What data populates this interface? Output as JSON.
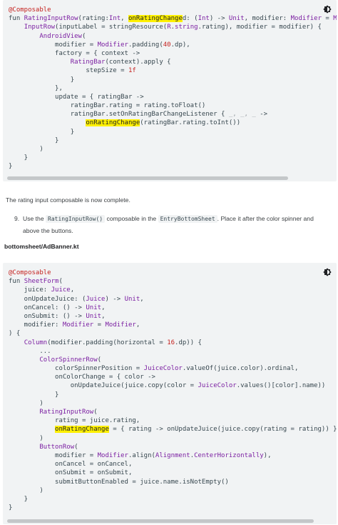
{
  "code_block_1": {
    "lines": [
      [
        {
          "t": "@Composable",
          "c": "ann"
        }
      ],
      [
        {
          "t": "fun ",
          "c": "kw"
        },
        {
          "t": "RatingInputRow",
          "c": "fn"
        },
        {
          "t": "(rating:",
          "c": "plain"
        },
        {
          "t": "Int",
          "c": "type"
        },
        {
          "t": ", ",
          "c": "plain"
        },
        {
          "t": "onRatingChange",
          "c": "hl"
        },
        {
          "t": "d: (",
          "c": "plain"
        },
        {
          "t": "Int",
          "c": "type"
        },
        {
          "t": ") -> ",
          "c": "plain"
        },
        {
          "t": "Unit",
          "c": "type"
        },
        {
          "t": ", modifier: ",
          "c": "plain"
        },
        {
          "t": "Modifier",
          "c": "type"
        },
        {
          "t": " = ",
          "c": "plain"
        },
        {
          "t": "Modi",
          "c": "type"
        }
      ],
      [
        {
          "t": "    ",
          "c": "plain"
        },
        {
          "t": "InputRow",
          "c": "fn"
        },
        {
          "t": "(inputLabel = stringResource(",
          "c": "plain"
        },
        {
          "t": "R",
          "c": "type"
        },
        {
          "t": ".",
          "c": "plain"
        },
        {
          "t": "string",
          "c": "fn"
        },
        {
          "t": ".rating), modifier = modifier) {",
          "c": "plain"
        }
      ],
      [
        {
          "t": "        ",
          "c": "plain"
        },
        {
          "t": "AndroidView",
          "c": "fn"
        },
        {
          "t": "(",
          "c": "plain"
        }
      ],
      [
        {
          "t": "            modifier = ",
          "c": "plain"
        },
        {
          "t": "Modifier",
          "c": "type"
        },
        {
          "t": ".padding(",
          "c": "plain"
        },
        {
          "t": "40",
          "c": "num"
        },
        {
          "t": ".dp),",
          "c": "plain"
        }
      ],
      [
        {
          "t": "            factory = { context ->",
          "c": "plain"
        }
      ],
      [
        {
          "t": "                ",
          "c": "plain"
        },
        {
          "t": "RatingBar",
          "c": "fn"
        },
        {
          "t": "(context).apply {",
          "c": "plain"
        }
      ],
      [
        {
          "t": "                    stepSize = ",
          "c": "plain"
        },
        {
          "t": "1f",
          "c": "num"
        }
      ],
      [
        {
          "t": "                }",
          "c": "plain"
        }
      ],
      [
        {
          "t": "            },",
          "c": "plain"
        }
      ],
      [
        {
          "t": "            update = { ratingBar ->",
          "c": "plain"
        }
      ],
      [
        {
          "t": "                ratingBar.rating = rating.toFloat()",
          "c": "plain"
        }
      ],
      [
        {
          "t": "                ratingBar.setOnRatingBarChangeListener { ",
          "c": "plain"
        },
        {
          "t": "_, _, _",
          "c": "dim"
        },
        {
          "t": " ->",
          "c": "plain"
        }
      ],
      [
        {
          "t": "                    ",
          "c": "plain"
        },
        {
          "t": "onRatingChange",
          "c": "hl"
        },
        {
          "t": "(ratingBar.rating.toInt())",
          "c": "plain"
        }
      ],
      [
        {
          "t": "                }",
          "c": "plain"
        }
      ],
      [
        {
          "t": "            }",
          "c": "plain"
        }
      ],
      [
        {
          "t": "        )",
          "c": "plain"
        }
      ],
      [
        {
          "t": "    }",
          "c": "plain"
        }
      ],
      [
        {
          "t": "}",
          "c": "plain"
        }
      ]
    ]
  },
  "paragraph_complete": "The rating input composable is now complete.",
  "step": {
    "number": "9.",
    "text_before": "Use the ",
    "chip_1": "RatingInputRow()",
    "text_middle": " composable in the ",
    "chip_2": "EntryBottomSheet",
    "text_after": ". Place it after the color spinner and above the buttons."
  },
  "file_name": "bottomsheet/AdBanner.kt",
  "code_block_2": {
    "lines": [
      [
        {
          "t": "@Composable",
          "c": "ann"
        }
      ],
      [
        {
          "t": "fun ",
          "c": "kw"
        },
        {
          "t": "SheetForm",
          "c": "fn"
        },
        {
          "t": "(",
          "c": "plain"
        }
      ],
      [
        {
          "t": "    juice: ",
          "c": "plain"
        },
        {
          "t": "Juice",
          "c": "type"
        },
        {
          "t": ",",
          "c": "plain"
        }
      ],
      [
        {
          "t": "    onUpdateJuice: (",
          "c": "plain"
        },
        {
          "t": "Juice",
          "c": "type"
        },
        {
          "t": ") -> ",
          "c": "plain"
        },
        {
          "t": "Unit",
          "c": "type"
        },
        {
          "t": ",",
          "c": "plain"
        }
      ],
      [
        {
          "t": "    onCancel: () -> ",
          "c": "plain"
        },
        {
          "t": "Unit",
          "c": "type"
        },
        {
          "t": ",",
          "c": "plain"
        }
      ],
      [
        {
          "t": "    onSubmit: () -> ",
          "c": "plain"
        },
        {
          "t": "Unit",
          "c": "type"
        },
        {
          "t": ",",
          "c": "plain"
        }
      ],
      [
        {
          "t": "    modifier: ",
          "c": "plain"
        },
        {
          "t": "Modifier",
          "c": "type"
        },
        {
          "t": " = ",
          "c": "plain"
        },
        {
          "t": "Modifier",
          "c": "type"
        },
        {
          "t": ",",
          "c": "plain"
        }
      ],
      [
        {
          "t": ") {",
          "c": "plain"
        }
      ],
      [
        {
          "t": "    ",
          "c": "plain"
        },
        {
          "t": "Column",
          "c": "fn"
        },
        {
          "t": "(modifier.padding(horizontal = ",
          "c": "plain"
        },
        {
          "t": "16",
          "c": "num"
        },
        {
          "t": ".dp)) {",
          "c": "plain"
        }
      ],
      [
        {
          "t": "        ...",
          "c": "plain"
        }
      ],
      [
        {
          "t": "        ",
          "c": "plain"
        },
        {
          "t": "ColorSpinnerRow",
          "c": "fn"
        },
        {
          "t": "(",
          "c": "plain"
        }
      ],
      [
        {
          "t": "            colorSpinnerPosition = ",
          "c": "plain"
        },
        {
          "t": "JuiceColor",
          "c": "type"
        },
        {
          "t": ".valueOf(juice.color).ordinal,",
          "c": "plain"
        }
      ],
      [
        {
          "t": "            onColorChange = { color ->",
          "c": "plain"
        }
      ],
      [
        {
          "t": "                onUpdateJuice(juice.copy(color = ",
          "c": "plain"
        },
        {
          "t": "JuiceColor",
          "c": "type"
        },
        {
          "t": ".values()[color].name))",
          "c": "plain"
        }
      ],
      [
        {
          "t": "            }",
          "c": "plain"
        }
      ],
      [
        {
          "t": "        )",
          "c": "plain"
        }
      ],
      [
        {
          "t": "        ",
          "c": "plain"
        },
        {
          "t": "RatingInputRow",
          "c": "fn"
        },
        {
          "t": "(",
          "c": "plain"
        }
      ],
      [
        {
          "t": "            rating = juice.rating,",
          "c": "plain"
        }
      ],
      [
        {
          "t": "            ",
          "c": "plain"
        },
        {
          "t": "onRatingChange",
          "c": "hl"
        },
        {
          "t": " = { rating -> onUpdateJuice(juice.copy(rating = rating)) }",
          "c": "plain"
        }
      ],
      [
        {
          "t": "        )",
          "c": "plain"
        }
      ],
      [
        {
          "t": "        ",
          "c": "plain"
        },
        {
          "t": "ButtonRow",
          "c": "fn"
        },
        {
          "t": "(",
          "c": "plain"
        }
      ],
      [
        {
          "t": "            modifier = ",
          "c": "plain"
        },
        {
          "t": "Modifier",
          "c": "type"
        },
        {
          "t": ".align(",
          "c": "plain"
        },
        {
          "t": "Alignment",
          "c": "type"
        },
        {
          "t": ".",
          "c": "plain"
        },
        {
          "t": "CenterHorizontally",
          "c": "fn"
        },
        {
          "t": "),",
          "c": "plain"
        }
      ],
      [
        {
          "t": "            onCancel = onCancel,",
          "c": "plain"
        }
      ],
      [
        {
          "t": "            onSubmit = onSubmit,",
          "c": "plain"
        }
      ],
      [
        {
          "t": "            submitButtonEnabled = juice.name.isNotEmpty()",
          "c": "plain"
        }
      ],
      [
        {
          "t": "        )",
          "c": "plain"
        }
      ],
      [
        {
          "t": "    }",
          "c": "plain"
        }
      ],
      [
        {
          "t": "}",
          "c": "plain"
        }
      ]
    ]
  },
  "icons": {
    "theme_toggle": "brightness-icon"
  },
  "colors": {
    "code_background": "#f1f3f4",
    "highlight": "#fff000",
    "annotation": "#c5221f",
    "identifier": "#7b1fa2"
  }
}
